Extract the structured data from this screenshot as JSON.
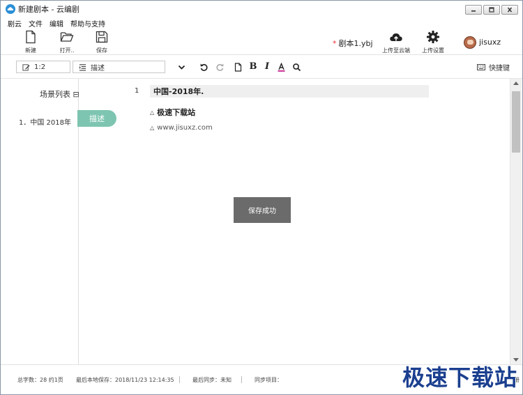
{
  "window": {
    "title": "新建剧本 - 云编剧"
  },
  "menu": [
    "剧云",
    "文件",
    "编辑",
    "帮助与支持"
  ],
  "toolbar": {
    "new_label": "新建",
    "open_label": "打开..",
    "save_label": "保存",
    "script_name": "剧本1.ybj",
    "upload_label": "上传至云端",
    "upload_settings_label": "上传设置",
    "username": "jisuxz"
  },
  "format": {
    "page_field": "1:2",
    "style_select": "描述",
    "shortcuts_label": "快捷键"
  },
  "sidebar": {
    "title": "场景列表",
    "title_suffix": "⊟",
    "items": [
      "1．中国 2018年"
    ],
    "tag_label": "描述"
  },
  "editor": {
    "line_number": "1",
    "heading": "中国-2018年.",
    "lines": [
      "极速下载站",
      "www.jisuxz.com"
    ]
  },
  "toast": "保存成功",
  "status": {
    "word_count": "总字数：28 约1页",
    "last_save": "最后本地保存：2018/11/23 12:14:35",
    "last_sync": "最后同步：未知",
    "sync_items": "同步项目：",
    "right": "册"
  },
  "watermark": "极速下载站",
  "colors": {
    "accent": "#7ec5b1",
    "app_icon": "#2b8fd6",
    "toast": "#6b6b6b",
    "watermark": "#1b3f8f"
  }
}
